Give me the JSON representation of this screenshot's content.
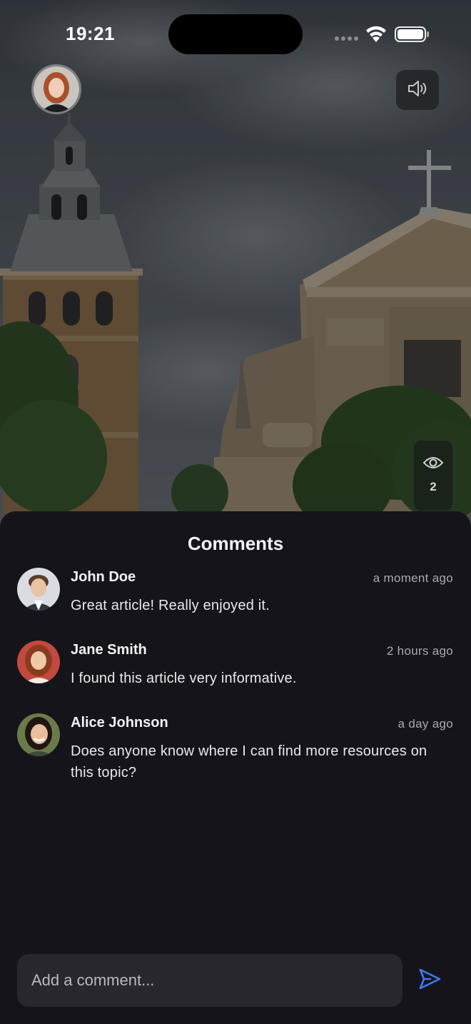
{
  "status_bar": {
    "time": "19:21"
  },
  "post": {
    "views_count": "2"
  },
  "comments_sheet": {
    "title": "Comments",
    "comments": [
      {
        "name": "John Doe",
        "time": "a moment ago",
        "text": "Great article! Really enjoyed it."
      },
      {
        "name": "Jane Smith",
        "time": "2 hours ago",
        "text": "I found this article very informative."
      },
      {
        "name": "Alice Johnson",
        "time": "a day ago",
        "text": "Does anyone know where I can find more resources on this topic?"
      }
    ],
    "input": {
      "placeholder": "Add a comment..."
    }
  },
  "icons": {
    "sound": "speaker-icon",
    "views": "eye-icon",
    "send": "send-icon",
    "wifi": "wifi-icon",
    "battery": "battery-icon"
  },
  "colors": {
    "accent": "#3d7cf0",
    "sheet_bg": "#15141b",
    "input_bg": "#28272d"
  }
}
